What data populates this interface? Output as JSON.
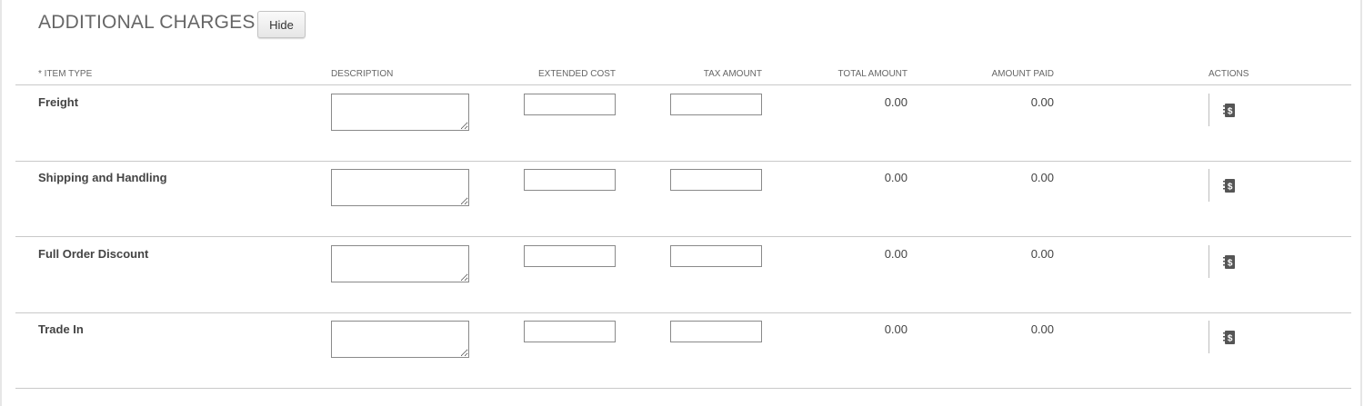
{
  "section": {
    "title": "ADDITIONAL CHARGES",
    "hide_label": "Hide"
  },
  "columns": {
    "item_type": "* ITEM TYPE",
    "description": "DESCRIPTION",
    "extended_cost": "EXTENDED COST",
    "tax_amount": "TAX AMOUNT",
    "total_amount": "TOTAL AMOUNT",
    "amount_paid": "AMOUNT PAID",
    "actions": "ACTIONS"
  },
  "rows": [
    {
      "item_type": "Freight",
      "description": "",
      "extended_cost": "",
      "tax_amount": "",
      "total_amount": "0.00",
      "amount_paid": "0.00",
      "action_icon": "dollar-ledger-icon"
    },
    {
      "item_type": "Shipping and Handling",
      "description": "",
      "extended_cost": "",
      "tax_amount": "",
      "total_amount": "0.00",
      "amount_paid": "0.00",
      "action_icon": "dollar-ledger-icon"
    },
    {
      "item_type": "Full Order Discount",
      "description": "",
      "extended_cost": "",
      "tax_amount": "",
      "total_amount": "0.00",
      "amount_paid": "0.00",
      "action_icon": "dollar-ledger-icon"
    },
    {
      "item_type": "Trade In",
      "description": "",
      "extended_cost": "",
      "tax_amount": "",
      "total_amount": "0.00",
      "amount_paid": "0.00",
      "action_icon": "dollar-ledger-icon"
    }
  ],
  "colors": {
    "title": "#666666",
    "rule": "#c9c9c9",
    "icon": "#555555"
  }
}
